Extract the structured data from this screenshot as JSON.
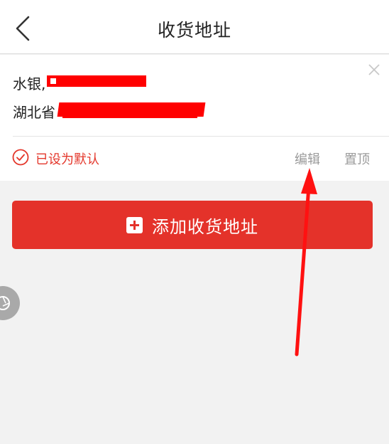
{
  "header": {
    "title": "收货地址",
    "back_icon": "chevron-left-icon"
  },
  "address": {
    "name": "水银,",
    "address_prefix": "湖北省",
    "default_label": "已设为默认",
    "edit_label": "编辑",
    "pin_label": "置顶"
  },
  "actions": {
    "add_address_label": "添加收货地址"
  },
  "colors": {
    "accent": "#e4322a",
    "redaction": "#ff0000",
    "muted_text": "#9a9a9a",
    "background": "#f2f2f2"
  }
}
